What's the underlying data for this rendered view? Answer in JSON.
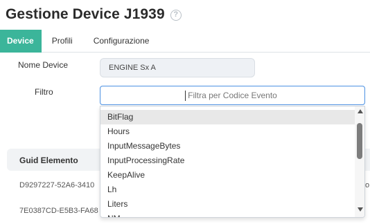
{
  "header": {
    "title": "Gestione Device J1939",
    "help_icon": "question-circle-icon"
  },
  "tabs": [
    {
      "label": "Device",
      "active": true
    },
    {
      "label": "Profili",
      "active": false
    },
    {
      "label": "Configurazione",
      "active": false
    }
  ],
  "form": {
    "device_label": "Nome Device",
    "device_value": "ENGINE Sx A",
    "filter_label": "Filtro",
    "filter_placeholder": "Filtra per Codice Evento",
    "filter_value": ""
  },
  "dropdown": {
    "options": [
      "BitFlag",
      "Hours",
      "InputMessageBytes",
      "InputProcessingRate",
      "KeepAlive",
      "Lh",
      "Liters",
      "NM"
    ],
    "highlighted_index": 0
  },
  "table": {
    "header": "Guid Elemento",
    "rows": [
      {
        "guid": "D9297227-52A6-3410",
        "edge": "o"
      },
      {
        "guid": "7E0387CD-E5B3-FA68",
        "edge": ""
      }
    ]
  },
  "colors": {
    "accent": "#3bb59a",
    "focus_border": "#4a90e2"
  }
}
